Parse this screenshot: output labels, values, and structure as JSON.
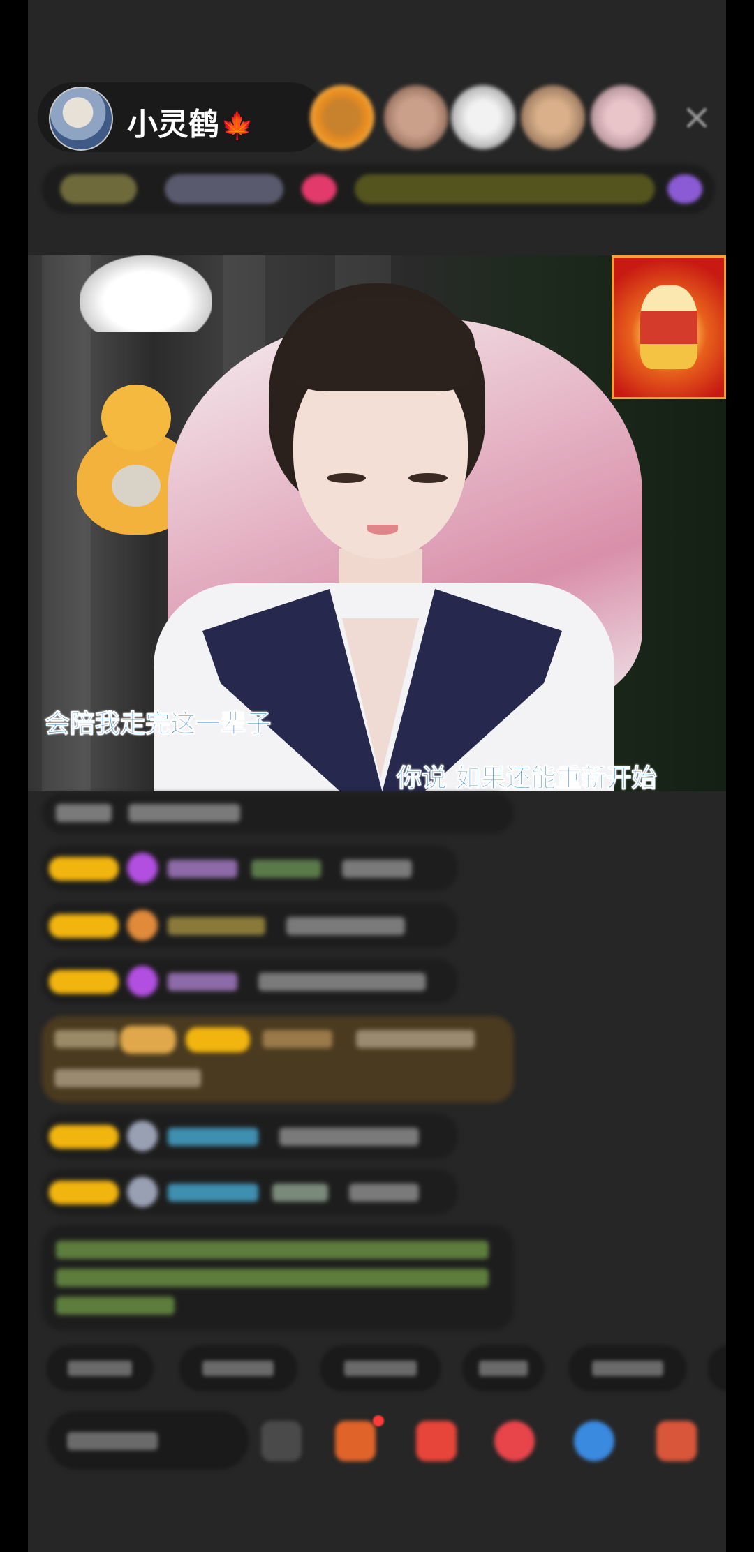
{
  "anchor": {
    "name": "小灵鹤",
    "badge_icon": "maple-leaf-icon"
  },
  "header": {
    "close_icon": "close-icon"
  },
  "stream": {
    "subtitle_left": "会陪我走完这一辈子",
    "subtitle_right": "你说  如果还能重新开始"
  },
  "colors": {
    "subtitle": "#1f7fd8",
    "level_badge": "#f2b50f",
    "chat_bg": "#1d1d1d",
    "page_bg": "#262626"
  }
}
